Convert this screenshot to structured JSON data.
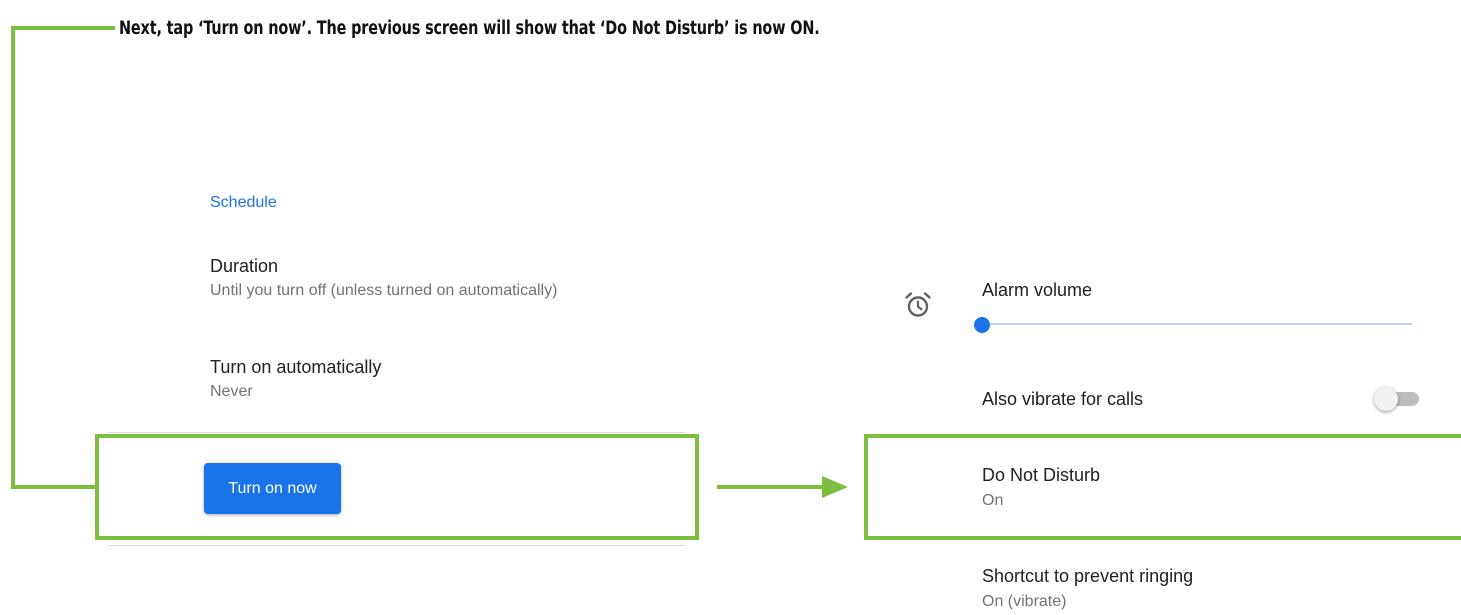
{
  "instruction": {
    "text": "Next, tap ‘Turn on now’.  The previous screen will show that ‘Do Not Disturb’ is now ON."
  },
  "left_pane": {
    "section_header": "Schedule",
    "duration": {
      "title": "Duration",
      "subtitle": "Until you turn off (unless turned on automatically)"
    },
    "turn_on_automatically": {
      "title": "Turn on automatically",
      "subtitle": "Never"
    },
    "turn_on_now_button": "Turn on now"
  },
  "right_pane": {
    "alarm_volume": {
      "title": "Alarm volume",
      "icon": "alarm-clock-icon",
      "level_fraction": 0.0
    },
    "also_vibrate": {
      "title": "Also vibrate for calls",
      "toggle_state": "off"
    },
    "do_not_disturb": {
      "title": "Do Not Disturb",
      "subtitle": "On"
    },
    "shortcut": {
      "title": "Shortcut to prevent ringing",
      "subtitle": "On (vibrate)"
    }
  },
  "colors": {
    "accent": "#1a73e8",
    "highlight": "#7cbf3e",
    "text_primary": "#202124",
    "text_secondary": "#6f7377"
  }
}
